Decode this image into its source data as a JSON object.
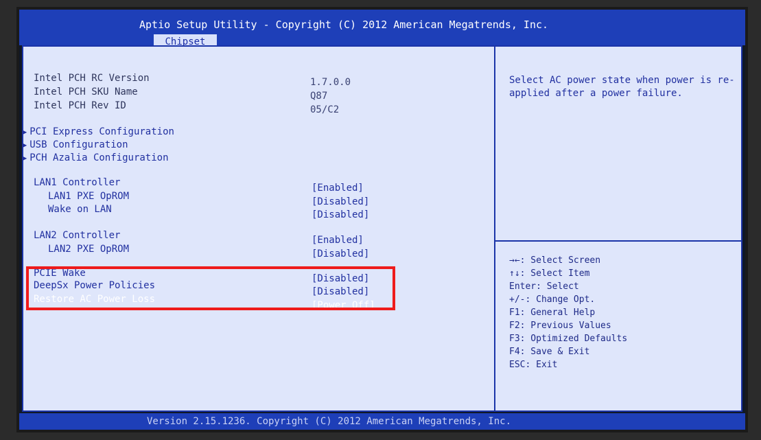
{
  "header": {
    "title": "Aptio Setup Utility - Copyright (C) 2012 American Megatrends, Inc.",
    "active_tab": "Chipset"
  },
  "info": [
    {
      "label": "Intel PCH RC Version",
      "value": "1.7.0.0"
    },
    {
      "label": "Intel PCH SKU Name",
      "value": "Q87"
    },
    {
      "label": "Intel PCH Rev ID",
      "value": "05/C2"
    }
  ],
  "submenus": [
    {
      "label": "PCI Express Configuration"
    },
    {
      "label": "USB Configuration"
    },
    {
      "label": "PCH Azalia Configuration"
    }
  ],
  "options": {
    "lan1": {
      "label": "LAN1 Controller",
      "value": "[Enabled]"
    },
    "lan1_pxe": {
      "label": "LAN1 PXE OpROM",
      "value": "[Disabled]"
    },
    "wake_lan": {
      "label": "Wake on LAN",
      "value": "[Disabled]"
    },
    "lan2": {
      "label": "LAN2 Controller",
      "value": "[Enabled]"
    },
    "lan2_pxe": {
      "label": "LAN2 PXE OpROM",
      "value": "[Disabled]"
    },
    "pcie_wake": {
      "label": "PCIE Wake",
      "value": "[Disabled]"
    },
    "deepsx": {
      "label": "DeepSx Power Policies",
      "value": "[Disabled]"
    },
    "restore_ac": {
      "label": "Restore AC Power Loss",
      "value": "[Power Off]"
    }
  },
  "help": {
    "text": "Select AC power state when power is re-applied after a power failure."
  },
  "keys": [
    "→←: Select Screen",
    "↑↓: Select Item",
    "Enter: Select",
    "+/-: Change Opt.",
    "F1: General Help",
    "F2: Previous Values",
    "F3: Optimized Defaults",
    "F4: Save & Exit",
    "ESC: Exit"
  ],
  "footer": {
    "text": "Version 2.15.1236. Copyright (C) 2012 American Megatrends, Inc."
  },
  "colors": {
    "title_bar": "#1e3fb8",
    "panel": "#dfe6fb",
    "text": "#2130a0",
    "selected_text": "#ffffff",
    "highlight_box": "#ee1b1b"
  }
}
